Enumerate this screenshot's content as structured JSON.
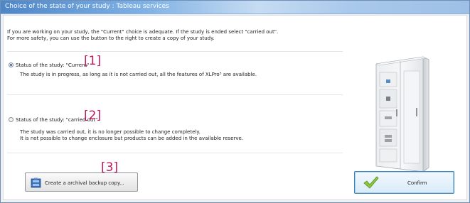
{
  "window": {
    "title": "Choice of the state of your study : Tableau services"
  },
  "intro": {
    "line1": "If you are working on your study, the \"Current\" choice is adequate. If the study is ended select \"carried out\".",
    "line2": "For more safety, you can use the button to the right to create a copy of your study."
  },
  "options": [
    {
      "label": "Status of the study: \"Current\"",
      "selected": true,
      "description_lines": [
        "The study is in progress, as long as it is not carried out, all the features of XLPro³ are available."
      ]
    },
    {
      "label": "Status of the study: \"carried out\"",
      "selected": false,
      "description_lines": [
        "The study was carried out, it is no longer possible to change completely.",
        "It is not possible to change enclosure but products can be added in the available reserve."
      ]
    }
  ],
  "callouts": [
    "[1]",
    "[2]",
    "[3]"
  ],
  "buttons": {
    "backup_label": "Create a archival backup copy...",
    "confirm_label": "Confirm"
  },
  "colors": {
    "callout": "#c2185b",
    "check": "#8cc63f",
    "title_bar": "#4f86c6"
  }
}
